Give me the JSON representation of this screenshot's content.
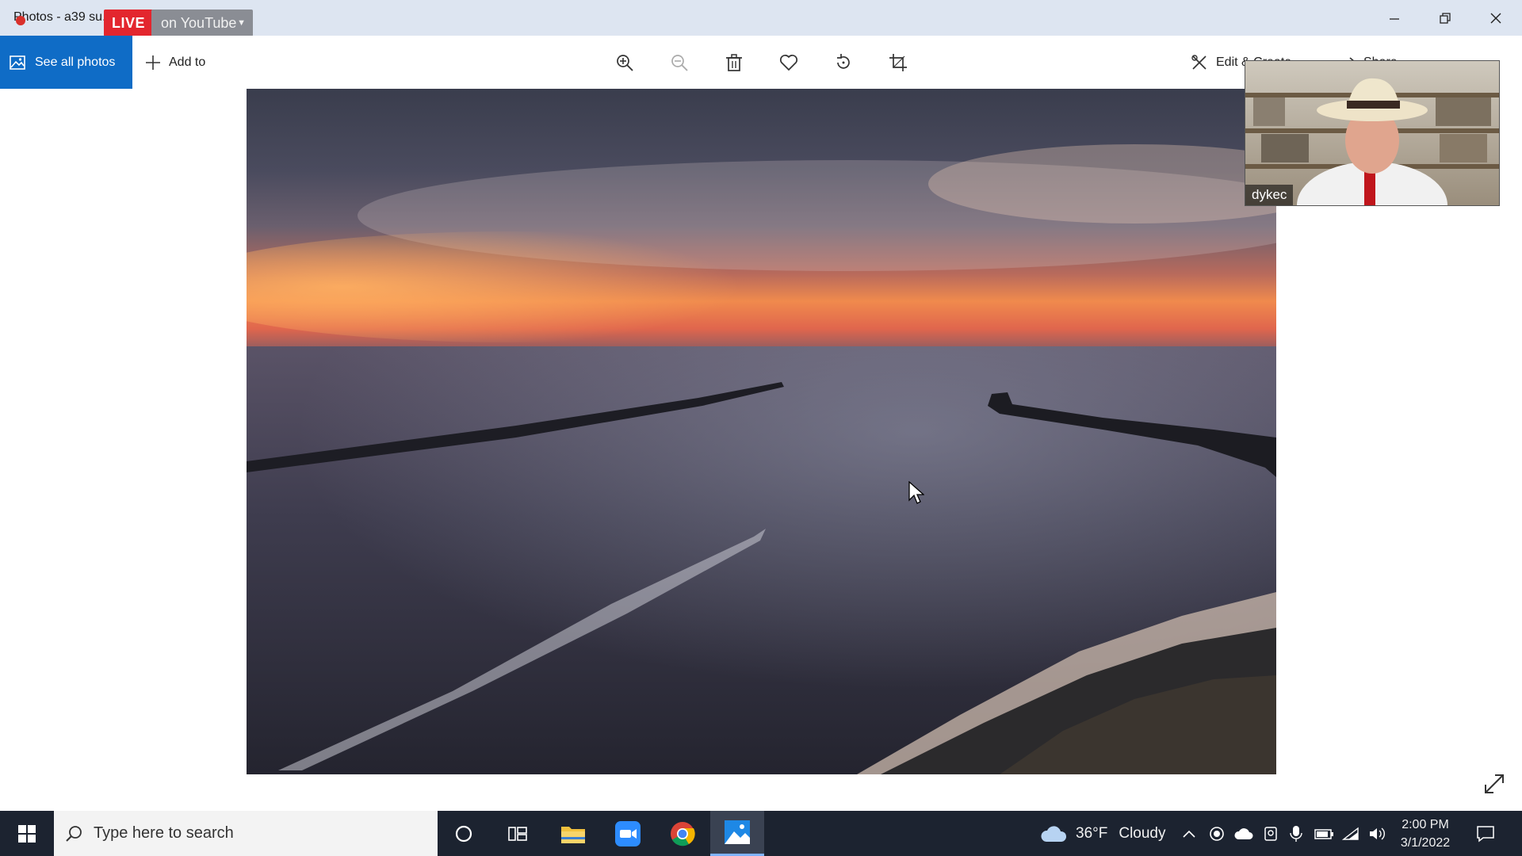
{
  "window": {
    "title": "Photos - a39 su...n.JPG",
    "live_badge": "LIVE",
    "stream_target": "on YouTube"
  },
  "commandbar": {
    "see_all_label": "See all photos",
    "add_to_label": "Add to",
    "edit_create_label": "Edit & Create",
    "share_label": "Share",
    "tools": [
      "zoom-in-icon",
      "zoom-out-icon",
      "trash-icon",
      "heart-icon",
      "rotate-icon",
      "crop-icon"
    ]
  },
  "video_call": {
    "participant_name": "dykec"
  },
  "taskbar": {
    "search_placeholder": "Type here to search",
    "weather_temp": "36°F",
    "weather_condition": "Cloudy",
    "time": "2:00 PM",
    "date": "3/1/2022",
    "pinned": [
      "cortana-icon",
      "task-view-icon",
      "file-explorer-icon",
      "zoom-icon",
      "chrome-icon",
      "photos-icon"
    ]
  },
  "colors": {
    "accent": "#0f6cc6",
    "live_red": "#e3262e",
    "taskbar_bg": "#1c2330"
  }
}
